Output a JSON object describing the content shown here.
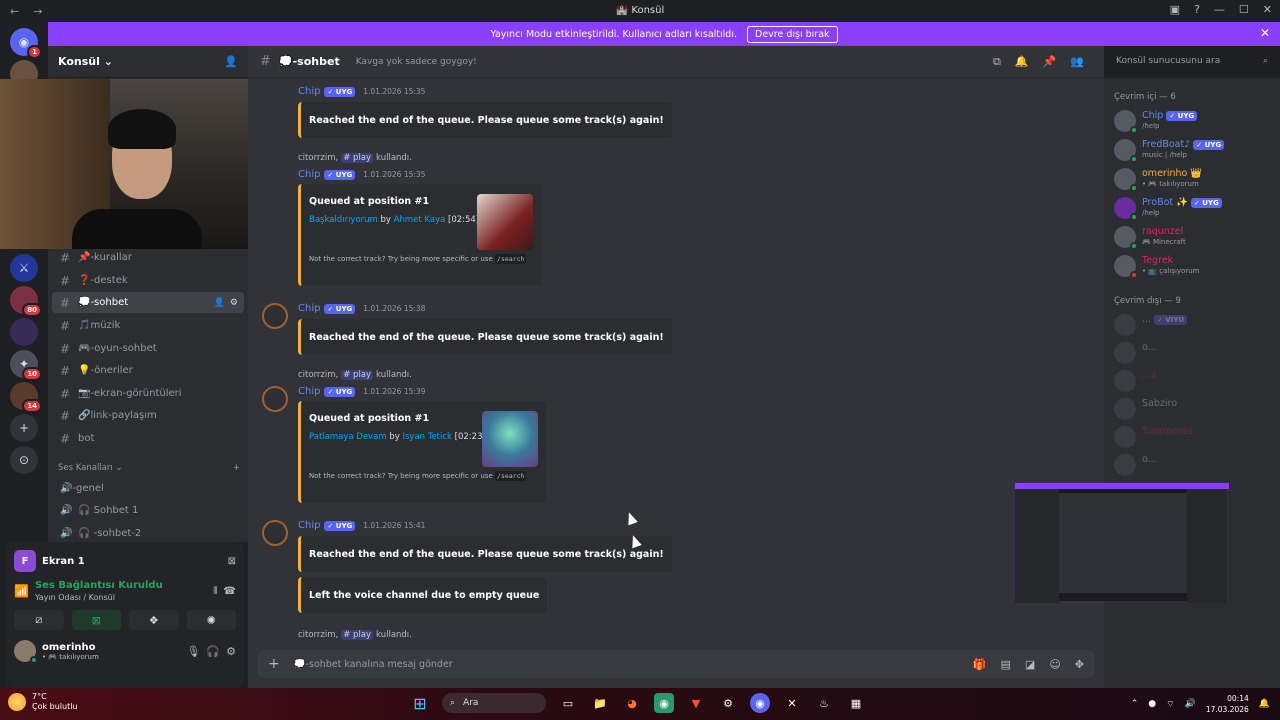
{
  "window": {
    "title": "Konsül"
  },
  "banner": {
    "text": "Yayıncı Modu etkinleştirildi. Kullanıcı adları kısaltıldı.",
    "button": "Devre dışı bırak"
  },
  "server": {
    "name": "Konsül"
  },
  "rail": {
    "badges": [
      "1",
      "80",
      "10",
      "14"
    ]
  },
  "channels": [
    {
      "label": "📌-kurallar"
    },
    {
      "label": "❓-destek"
    },
    {
      "label": "💭-sohbet"
    },
    {
      "label": "🎵müzik"
    },
    {
      "label": "🎮-oyun-sohbet"
    },
    {
      "label": "💡-öneriler"
    },
    {
      "label": "📷-ekran-görüntüleri"
    },
    {
      "label": "🔗link-paylaşım"
    },
    {
      "label": "bot"
    }
  ],
  "voice_category": "Ses Kanalları",
  "voice_channels": [
    {
      "label": "🔊-genel"
    },
    {
      "label": "🎧 Sohbet 1"
    },
    {
      "label": "🎧 -sohbet-2"
    }
  ],
  "panel": {
    "screen_name": "Ekran 1",
    "screen_initial": "F",
    "voice_status": "Ses Bağlantısı Kuruldu",
    "voice_sub": "Yayın Odası / Konsül"
  },
  "user": {
    "name": "omerinho",
    "status": "• 🎮 takılıyorum"
  },
  "chat": {
    "channel": "💭-sohbet",
    "topic": "Kavga yok sadece goygoy!",
    "bot_name": "Chip",
    "bot_tag": "✓ UYG",
    "messages": [
      {
        "time": "1.01.2026 15:35",
        "text": "Reached the end of the queue. Please queue some track(s) again!"
      },
      {
        "reply_user": "citorrzim,",
        "reply_cmd": "# play",
        "reply_suffix": "kullandı.",
        "time": "1.01.2026 15:35",
        "title": "Queued at position #1",
        "song": "Başkaldırıyorum",
        "by": "by",
        "artist": "Ahmet Kaya",
        "duration": "[02:54]",
        "footer": "Not the correct track? Try being more specific or use",
        "footer_code": "/search"
      },
      {
        "time": "1.01.2026 15:38",
        "text": "Reached the end of the queue. Please queue some track(s) again!"
      },
      {
        "reply_user": "citorrzim,",
        "reply_cmd": "# play",
        "reply_suffix": "kullandı.",
        "time": "1.01.2026 15:39",
        "title": "Queued at position #1",
        "song": "Patlamaya Devam",
        "by": "by",
        "artist": "Isyan Tetick",
        "duration": "[02:23]",
        "footer": "Not the correct track? Try being more specific or use",
        "footer_code": "/search"
      },
      {
        "time": "1.01.2026 15:41",
        "text": "Reached the end of the queue. Please queue some track(s) again!",
        "text2": "Left the voice channel due to empty queue"
      },
      {
        "reply_user": "citorrzim,",
        "reply_cmd": "# play",
        "reply_suffix": "kullandı."
      }
    ],
    "placeholder": "💭-sohbet kanalına mesaj gönder"
  },
  "search": {
    "placeholder": "Konsül sunucusunu ara"
  },
  "members": {
    "online_header": "Çevrim içi — 6",
    "offline_header": "Çevrim dışı — 9",
    "online": [
      {
        "name": "Chip",
        "tag": "✓ UYG",
        "status": "/help",
        "color": "#5d8cf0"
      },
      {
        "name": "FredBoat♪",
        "tag": "✓ UYG",
        "status": "music | /help",
        "color": "#5d8cf0"
      },
      {
        "name": "omerinho 👑",
        "tag": "",
        "status": "• 🎮 takılıyorum",
        "color": "#f0b232"
      },
      {
        "name": "ProBot ✨",
        "tag": "✓ UYG",
        "status": "/help",
        "color": "#5d8cf0"
      },
      {
        "name": "raqunzel",
        "tag": "",
        "status": "🎮 Minecraft",
        "color": "#e91e63"
      },
      {
        "name": "Tegrek",
        "tag": "",
        "status": "• 📺 çalışıyorum",
        "color": "#e91e63"
      }
    ],
    "offline": [
      {
        "name": "...",
        "tag": "✓ VIYU"
      },
      {
        "name": "o..."
      },
      {
        "name": "...a"
      },
      {
        "name": "Sabziro"
      },
      {
        "name": "Toosmeras"
      },
      {
        "name": "o..."
      }
    ]
  },
  "taskbar": {
    "temp": "7°C",
    "weather": "Çok bulutlu",
    "search": "Ara",
    "time": "00:14",
    "date": "17.03.2026"
  }
}
